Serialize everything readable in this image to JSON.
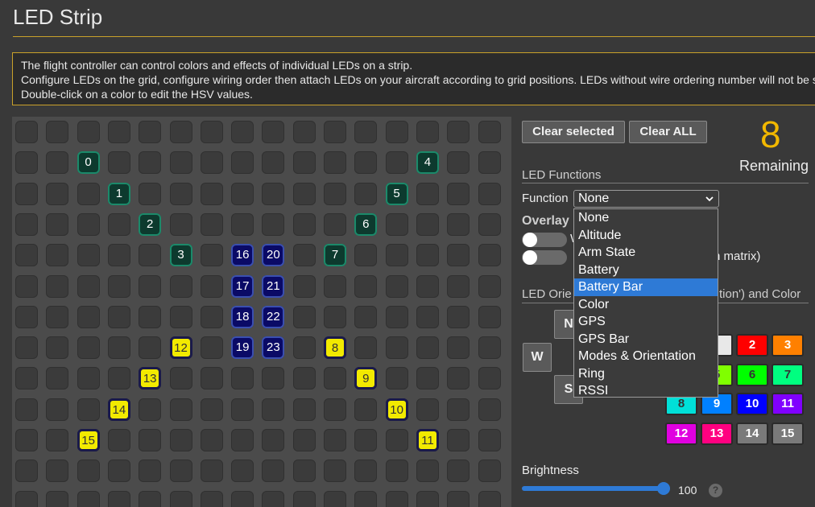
{
  "page": {
    "title": "LED Strip"
  },
  "note": {
    "lines": [
      "The flight controller can control colors and effects of individual LEDs on a strip.",
      "Configure LEDs on the grid, configure wiring order then attach LEDs on your aircraft according to grid positions. LEDs without wire ordering number will not be saved.",
      "Double-click on a color to edit the HSV values."
    ]
  },
  "grid": {
    "cols": 16,
    "rows": 13,
    "leds": [
      {
        "label": "0",
        "col": 2,
        "row": 1,
        "style": "green"
      },
      {
        "label": "1",
        "col": 3,
        "row": 2,
        "style": "green"
      },
      {
        "label": "2",
        "col": 4,
        "row": 3,
        "style": "green"
      },
      {
        "label": "3",
        "col": 5,
        "row": 4,
        "style": "green"
      },
      {
        "label": "4",
        "col": 13,
        "row": 1,
        "style": "green"
      },
      {
        "label": "5",
        "col": 12,
        "row": 2,
        "style": "green"
      },
      {
        "label": "6",
        "col": 11,
        "row": 3,
        "style": "green"
      },
      {
        "label": "7",
        "col": 10,
        "row": 4,
        "style": "green"
      },
      {
        "label": "16",
        "col": 7,
        "row": 4,
        "style": "blue"
      },
      {
        "label": "20",
        "col": 8,
        "row": 4,
        "style": "blue"
      },
      {
        "label": "17",
        "col": 7,
        "row": 5,
        "style": "blue"
      },
      {
        "label": "21",
        "col": 8,
        "row": 5,
        "style": "blue"
      },
      {
        "label": "18",
        "col": 7,
        "row": 6,
        "style": "blue"
      },
      {
        "label": "22",
        "col": 8,
        "row": 6,
        "style": "blue"
      },
      {
        "label": "19",
        "col": 7,
        "row": 7,
        "style": "blue"
      },
      {
        "label": "23",
        "col": 8,
        "row": 7,
        "style": "blue"
      },
      {
        "label": "12",
        "col": 5,
        "row": 7,
        "style": "yellow"
      },
      {
        "label": "8",
        "col": 10,
        "row": 7,
        "style": "yellow"
      },
      {
        "label": "13",
        "col": 4,
        "row": 8,
        "style": "yellow"
      },
      {
        "label": "9",
        "col": 11,
        "row": 8,
        "style": "yellow"
      },
      {
        "label": "14",
        "col": 3,
        "row": 9,
        "style": "yellow"
      },
      {
        "label": "10",
        "col": 12,
        "row": 9,
        "style": "yellow"
      },
      {
        "label": "15",
        "col": 2,
        "row": 10,
        "style": "yellow"
      },
      {
        "label": "11",
        "col": 13,
        "row": 10,
        "style": "yellow"
      }
    ]
  },
  "toolbar": {
    "clear_selected": "Clear selected",
    "clear_all": "Clear ALL"
  },
  "remaining": {
    "count": "8",
    "label": "Remaining"
  },
  "functions": {
    "title": "LED Functions",
    "function_label": "Function",
    "selected": "None",
    "options": [
      "None",
      "Altitude",
      "Arm State",
      "Battery",
      "Battery Bar",
      "Color",
      "GPS",
      "GPS Bar",
      "Modes & Orientation",
      "Ring",
      "RSSI"
    ],
    "highlighted": "Battery Bar"
  },
  "overlay": {
    "title": "Overlay",
    "toggle1_text": "W",
    "toggle2_text": "n matrix)"
  },
  "orientation": {
    "title_left": "LED Orie",
    "title_right": "tion') and Color",
    "dir_n": "N",
    "dir_w": "W",
    "dir_s": "S"
  },
  "colors": {
    "buttons": [
      {
        "label": "2",
        "bg": "#ff0000",
        "fg": "#ffffff"
      },
      {
        "label": "3",
        "bg": "#ff8000",
        "fg": "#ffffff"
      },
      {
        "label": "5",
        "bg": "#80ff00",
        "fg": "#333333"
      },
      {
        "label": "6",
        "bg": "#00ff00",
        "fg": "#333333"
      },
      {
        "label": "7",
        "bg": "#00ff80",
        "fg": "#333333"
      },
      {
        "label": "8",
        "bg": "#00e0d8",
        "fg": "#333333"
      },
      {
        "label": "9",
        "bg": "#0080ff",
        "fg": "#ffffff"
      },
      {
        "label": "10",
        "bg": "#0000ff",
        "fg": "#ffffff"
      },
      {
        "label": "11",
        "bg": "#8000ff",
        "fg": "#ffffff"
      },
      {
        "label": "12",
        "bg": "#e000e0",
        "fg": "#ffffff"
      },
      {
        "label": "13",
        "bg": "#ff0080",
        "fg": "#ffffff"
      },
      {
        "label": "14",
        "bg": "#7a7a7a",
        "fg": "#ffffff"
      },
      {
        "label": "15",
        "bg": "#7a7a7a",
        "fg": "#ffffff"
      }
    ]
  },
  "brightness": {
    "label": "Brightness",
    "value": "100",
    "level": 1.0
  }
}
